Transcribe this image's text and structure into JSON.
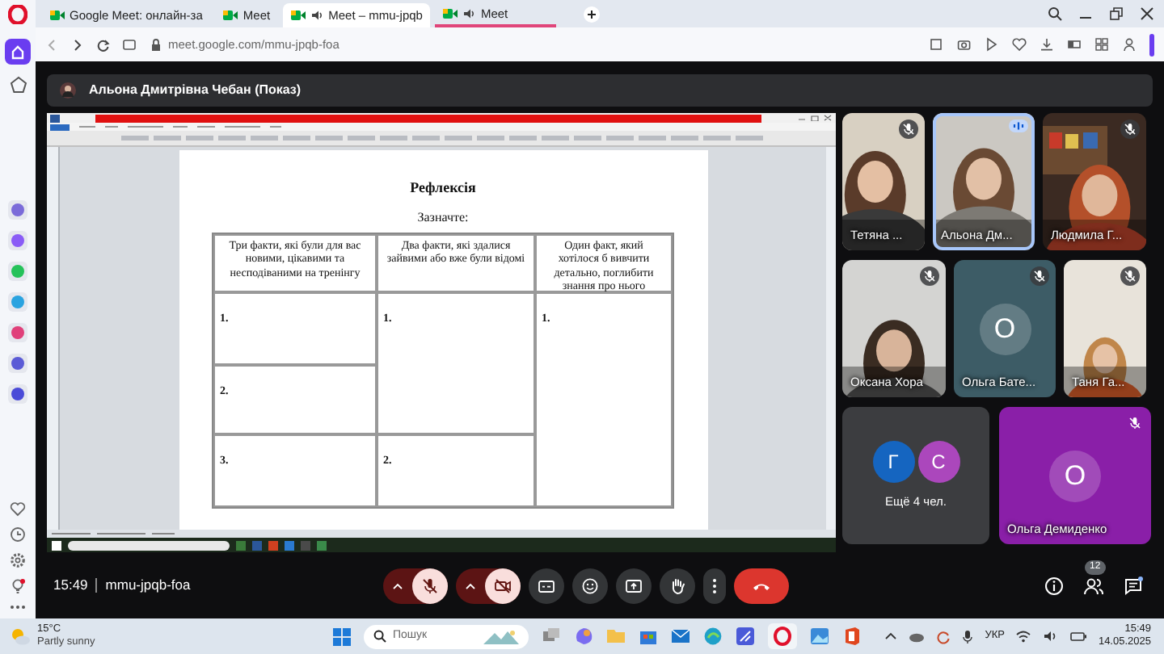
{
  "browser": {
    "tabs": [
      {
        "title": "Google Meet: онлайн-за",
        "selected": false,
        "audio": false,
        "underlined": false
      },
      {
        "title": "Meet",
        "selected": false,
        "audio": false,
        "underlined": false
      },
      {
        "title": "Meet – mmu-jpqb",
        "selected": true,
        "audio": true,
        "underlined": false
      },
      {
        "title": "Meet",
        "selected": false,
        "audio": true,
        "underlined": true
      }
    ],
    "url": "meet.google.com/mmu-jpqb-foa"
  },
  "meet": {
    "presenter": "Альона Дмитрівна Чебан (Показ)",
    "document": {
      "title": "Рефлексія",
      "subtitle": "Зазначте:",
      "columns": [
        "Три факти, які були для вас новими, цікавими та несподіваними на тренінгу",
        "Два факти, які здалися зайвими або вже були відомі",
        "Один факт, який хотілося б вивчити детально, поглибити знання про нього"
      ],
      "column_1": [
        "1.",
        "2.",
        "3."
      ],
      "column_2": [
        "1.",
        "2."
      ],
      "column_3": [
        "1."
      ]
    },
    "participants": [
      {
        "name": "Тетяна ...",
        "kind": "video",
        "muted": true,
        "speaking": false
      },
      {
        "name": "Альона Дм...",
        "kind": "video",
        "muted": false,
        "speaking": true
      },
      {
        "name": "Людмила Г...",
        "kind": "video",
        "muted": true,
        "speaking": false
      },
      {
        "name": "Оксана Хора",
        "kind": "video",
        "muted": true,
        "speaking": false
      },
      {
        "name": "Ольга Бате...",
        "kind": "avatar",
        "initial": "О",
        "color": "#3d5c66",
        "muted": true,
        "speaking": false
      },
      {
        "name": "Таня Га...",
        "kind": "video",
        "muted": true,
        "speaking": false
      },
      {
        "name": "Ольга Демиденко",
        "kind": "avatar",
        "initial": "О",
        "color": "#8a1fa8",
        "muted": true,
        "speaking": false
      }
    ],
    "more": {
      "label": "Ещё 4 чел.",
      "avatars": [
        {
          "initial": "Г",
          "color": "#1565c0"
        },
        {
          "initial": "С",
          "color": "#ab47bc"
        }
      ]
    },
    "call": {
      "time": "15:49",
      "code": "mmu-jpqb-foa",
      "mic_muted": true,
      "camera_off": true,
      "people_count": "12"
    }
  },
  "taskbar": {
    "temperature": "15°C",
    "weather": "Partly sunny",
    "search_placeholder": "Пошук",
    "language": "УКР",
    "time": "15:49",
    "date": "14.05.2025"
  }
}
